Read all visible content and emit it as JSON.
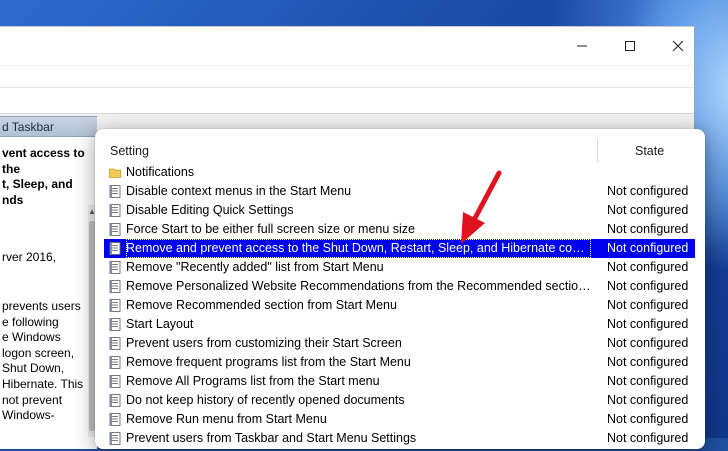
{
  "window": {
    "controls": {
      "minimize": "minimize-icon",
      "maximize": "maximize-icon",
      "close": "close-icon"
    }
  },
  "left_pane": {
    "header": "d Taskbar",
    "desc_title": "vent access to the\nt, Sleep, and\nnds",
    "desc_requirements": "rver 2016,",
    "desc_body": "prevents users\ne following\ne Windows\nlogon screen,\n Shut Down,\nHibernate. This\nnot prevent\nWindows-"
  },
  "list": {
    "col_setting": "Setting",
    "col_state": "State",
    "rows": [
      {
        "name": "Notifications",
        "state": "",
        "icon": "folder-icon"
      },
      {
        "name": "Disable context menus in the Start Menu",
        "state": "Not configured",
        "icon": "policy-icon"
      },
      {
        "name": "Disable Editing Quick Settings",
        "state": "Not configured",
        "icon": "policy-icon"
      },
      {
        "name": "Force Start to be either full screen size or menu size",
        "state": "Not configured",
        "icon": "policy-icon"
      },
      {
        "name": "Remove and prevent access to the Shut Down, Restart, Sleep, and Hibernate commands",
        "state": "Not configured",
        "icon": "policy-icon",
        "selected": true
      },
      {
        "name": "Remove \"Recently added\" list from Start Menu",
        "state": "Not configured",
        "icon": "policy-icon"
      },
      {
        "name": "Remove Personalized Website Recommendations from the Recommended section in the Start Menu",
        "state": "Not configured",
        "icon": "policy-icon"
      },
      {
        "name": "Remove Recommended section from Start Menu",
        "state": "Not configured",
        "icon": "policy-icon"
      },
      {
        "name": "Start Layout",
        "state": "Not configured",
        "icon": "policy-icon"
      },
      {
        "name": "Prevent users from customizing their Start Screen",
        "state": "Not configured",
        "icon": "policy-icon"
      },
      {
        "name": "Remove frequent programs list from the Start Menu",
        "state": "Not configured",
        "icon": "policy-icon"
      },
      {
        "name": "Remove All Programs list from the Start menu",
        "state": "Not configured",
        "icon": "policy-icon"
      },
      {
        "name": "Do not keep history of recently opened documents",
        "state": "Not configured",
        "icon": "policy-icon"
      },
      {
        "name": "Remove Run menu from Start Menu",
        "state": "Not configured",
        "icon": "policy-icon"
      },
      {
        "name": "Prevent users from Taskbar and Start Menu Settings",
        "state": "Not configured",
        "icon": "policy-icon"
      }
    ]
  },
  "colors": {
    "selection": "#0000f0",
    "annotation_arrow": "#e0121e",
    "pane_header": "#b8c6da"
  }
}
